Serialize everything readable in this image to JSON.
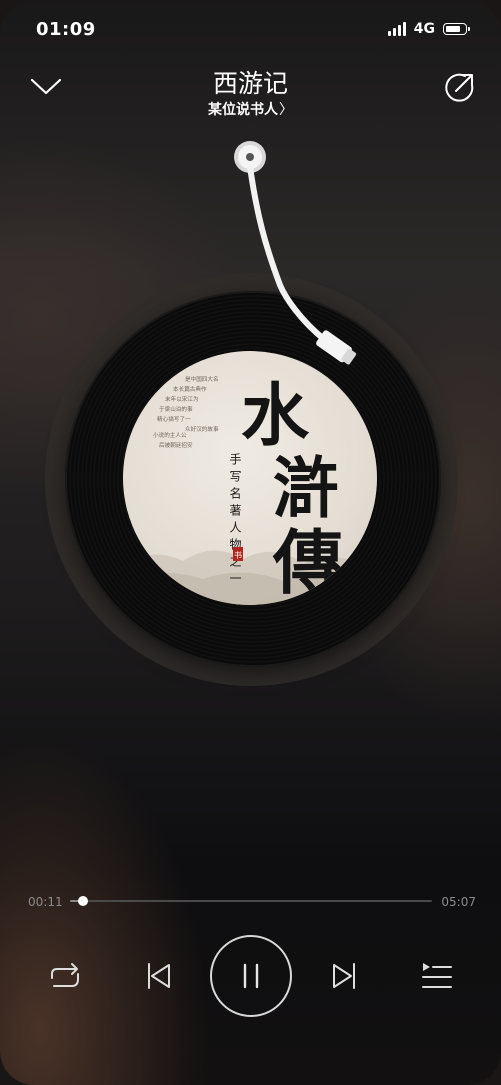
{
  "status_bar": {
    "time": "01:09",
    "network": "4G",
    "signal_icon": "cellular-signal-icon",
    "battery_icon": "battery-icon"
  },
  "header": {
    "title": "西游记",
    "subtitle": "某位说书人",
    "subtitle_chevron": "〉",
    "collapse_icon": "chevron-down-icon",
    "share_icon": "share-icon"
  },
  "album_art": {
    "big_text": [
      "水",
      "滸",
      "傳"
    ],
    "vertical_caption": "手写名著人物之一",
    "seal_text": "书",
    "small_text_lines": [
      "是中国四大名",
      "本长篇古典作",
      "末年以宋江为",
      "于梁山泊的事",
      "精心描写了一",
      "众好汉的故事",
      "小说的主人公",
      "后被朝廷招安"
    ]
  },
  "player": {
    "current_time": "00:11",
    "total_time": "05:07",
    "progress": 0.036
  },
  "controls": {
    "repeat_icon": "repeat-icon",
    "prev_icon": "skip-previous-icon",
    "play_pause_icon": "pause-icon",
    "next_icon": "skip-next-icon",
    "playlist_icon": "playlist-icon"
  },
  "colors": {
    "accent": "#ffffff",
    "seal_red": "#b3261e",
    "muted_text": "#8a8a8a"
  }
}
